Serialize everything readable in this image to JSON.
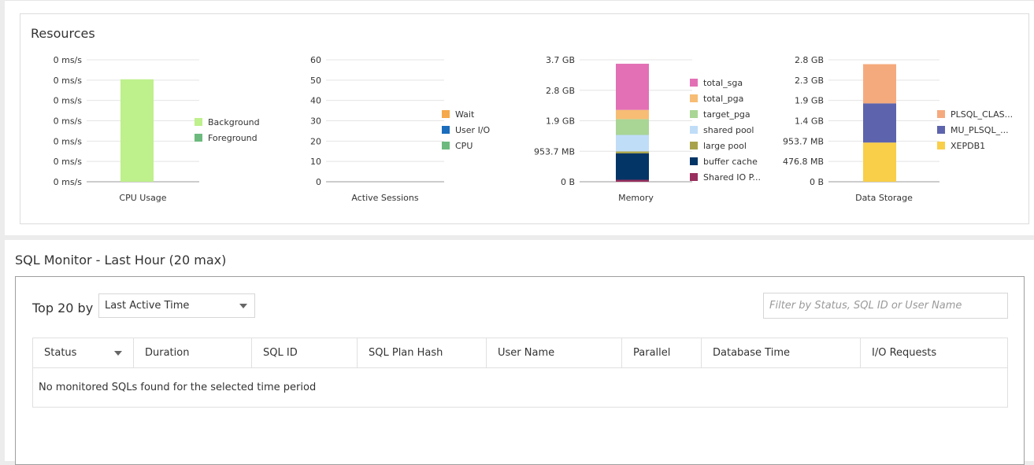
{
  "resources": {
    "title": "Resources"
  },
  "sql_monitor": {
    "title": "SQL Monitor - Last Hour (20 max)",
    "top_by_label": "Top 20 by",
    "sort_select_value": "Last Active Time",
    "filter_placeholder": "Filter by Status, SQL ID or User Name",
    "columns": [
      "Status",
      "Duration",
      "SQL ID",
      "SQL Plan Hash",
      "User Name",
      "Parallel",
      "Database Time",
      "I/O Requests"
    ],
    "empty_message": "No monitored SQLs found for the selected time period"
  },
  "chart_data": [
    {
      "type": "bar",
      "title": "",
      "xlabel": "CPU Usage",
      "y_ticks": [
        "0 ms/s",
        "0 ms/s",
        "0 ms/s",
        "0 ms/s",
        "0 ms/s",
        "0 ms/s",
        "0 ms/s"
      ],
      "stacked": true,
      "series": [
        {
          "name": "Background",
          "color": "#bef08c",
          "value_fraction": 0.84
        },
        {
          "name": "Foreground",
          "color": "#6cba7d",
          "value_fraction": 0
        }
      ]
    },
    {
      "type": "bar",
      "title": "",
      "xlabel": "Active Sessions",
      "ylim": [
        0,
        60
      ],
      "y_ticks": [
        "60",
        "50",
        "40",
        "30",
        "20",
        "10",
        "0"
      ],
      "stacked": true,
      "series": [
        {
          "name": "Wait",
          "color": "#f5a94a",
          "value": 0
        },
        {
          "name": "User I/O",
          "color": "#1a6dbc",
          "value": 0
        },
        {
          "name": "CPU",
          "color": "#6cba7d",
          "value": 0
        }
      ]
    },
    {
      "type": "bar",
      "title": "",
      "xlabel": "Memory",
      "ylim_bytes_gb": [
        0,
        3.7
      ],
      "y_ticks": [
        "3.7 GB",
        "2.8 GB",
        "1.9 GB",
        "953.7 MB",
        "0 B"
      ],
      "stacked": true,
      "series": [
        {
          "name": "total_sga",
          "color": "#e370b5",
          "value_gb": 1.4
        },
        {
          "name": "total_pga",
          "color": "#f7bd74",
          "value_gb": 0.28
        },
        {
          "name": "target_pga",
          "color": "#a9d595",
          "value_gb": 0.48
        },
        {
          "name": "shared pool",
          "color": "#c0ddf8",
          "value_gb": 0.5
        },
        {
          "name": "large pool",
          "color": "#a8a34b",
          "value_gb": 0.06
        },
        {
          "name": "buffer cache",
          "color": "#033566",
          "value_gb": 0.8
        },
        {
          "name": "Shared IO P...",
          "color": "#992f5e",
          "value_gb": 0.06
        }
      ]
    },
    {
      "type": "bar",
      "title": "",
      "xlabel": "Data Storage",
      "ylim_bytes_gb": [
        0,
        2.8
      ],
      "y_ticks": [
        "2.8 GB",
        "2.3 GB",
        "1.9 GB",
        "1.4 GB",
        "953.7 MB",
        "476.8 MB",
        "0 B"
      ],
      "stacked": true,
      "series": [
        {
          "name": "PLSQL_CLAS...",
          "color": "#f5aa7e",
          "value_gb": 0.9
        },
        {
          "name": "MU_PLSQL_...",
          "color": "#5d64ad",
          "value_gb": 0.9
        },
        {
          "name": "XEPDB1",
          "color": "#f9ce49",
          "value_gb": 0.9
        }
      ]
    }
  ]
}
